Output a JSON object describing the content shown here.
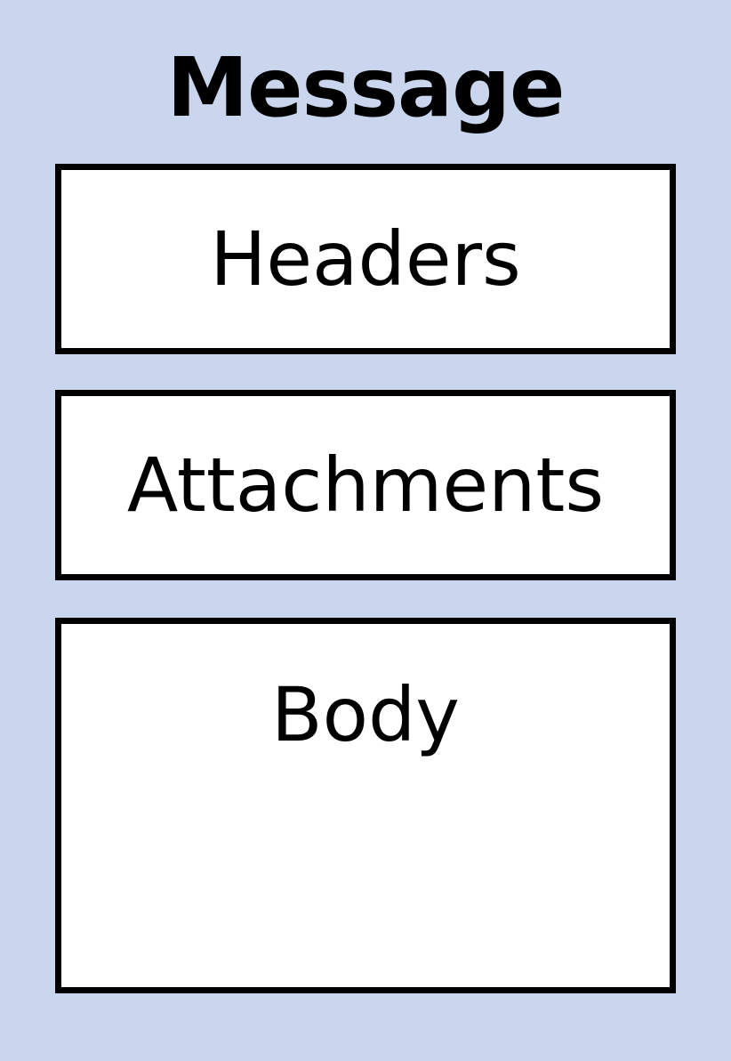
{
  "diagram": {
    "title": "Message",
    "parts": [
      {
        "label": "Headers"
      },
      {
        "label": "Attachments"
      },
      {
        "label": "Body"
      }
    ]
  },
  "colors": {
    "background": "#c9d6ee",
    "box_fill": "#ffffff",
    "box_border": "#000000",
    "text": "#000000"
  }
}
